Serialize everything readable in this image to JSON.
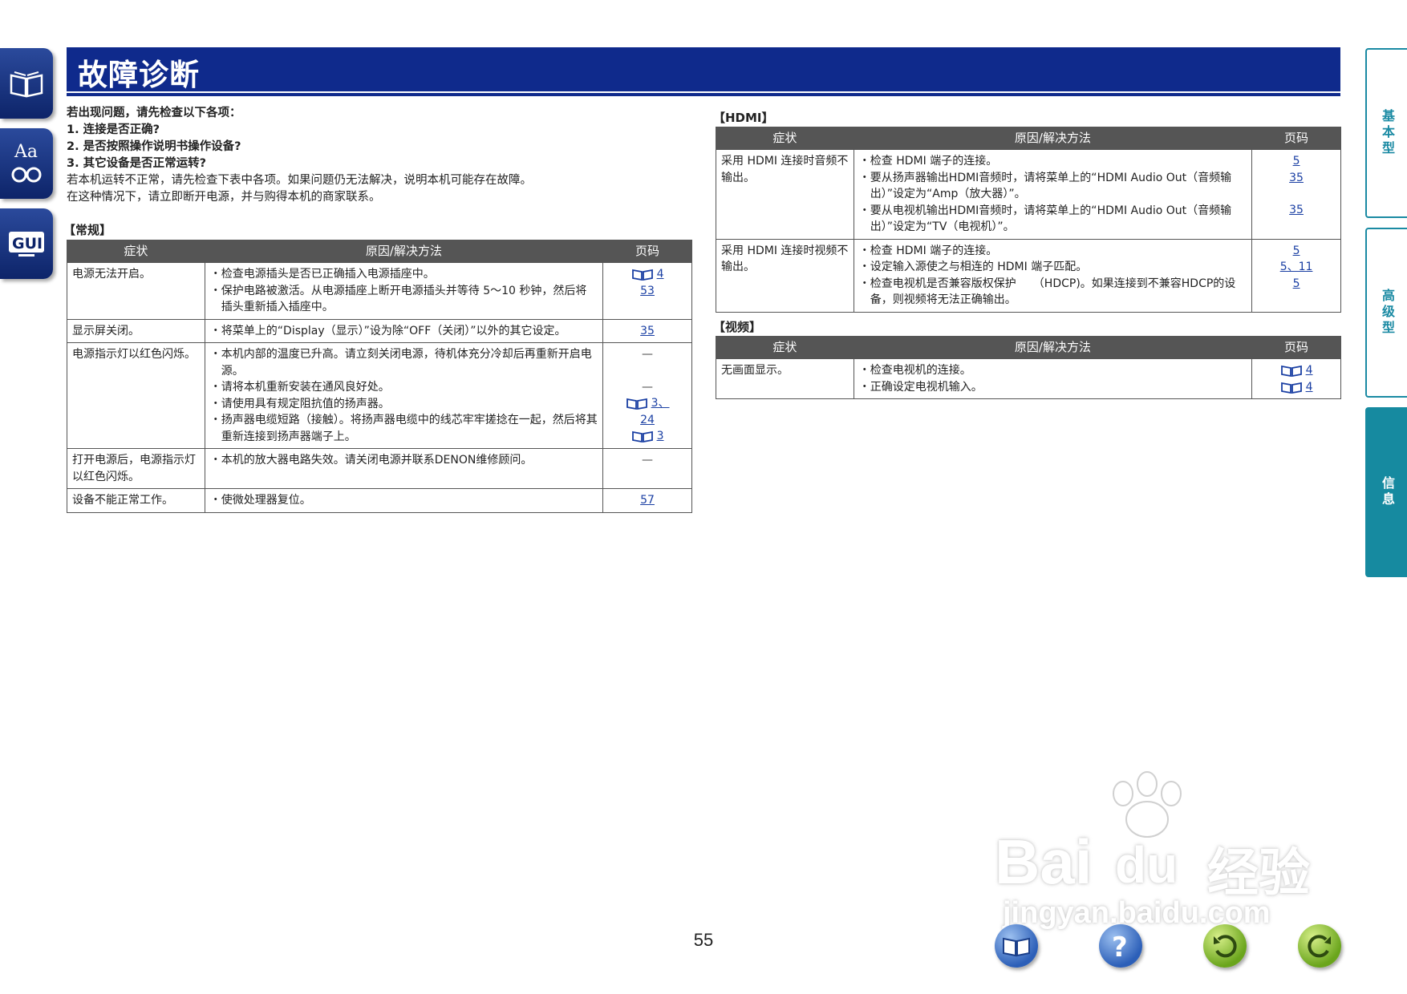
{
  "header": {
    "title": "故障诊断"
  },
  "right_tabs": [
    "基本型",
    "高级型",
    "信息"
  ],
  "intro": {
    "line1": "若出现问题，请先检查以下各项：",
    "line2": "1. 连接是否正确?",
    "line3": "2. 是否按照操作说明书操作设备?",
    "line4": "3. 其它设备是否正常运转?",
    "line5": "若本机运转不正常，请先检查下表中各项。如果问题仍无法解决，说明本机可能存在故障。",
    "line6": "在这种情况下，请立即断开电源，并与购得本机的商家联系。"
  },
  "columns": {
    "symptom": "症状",
    "cause": "原因/解决方法",
    "page": "页码"
  },
  "general": {
    "label": "【常规】",
    "rows": [
      {
        "symptom": "电源无法开启。",
        "causes": [
          "・检查电源插头是否已正确插入电源插座中。",
          "・保护电路被激活。从电源插座上断开电源插头并等待 5～10 秒钟，然后将插头重新插入插座中。"
        ],
        "pages": [
          "4",
          "53"
        ]
      },
      {
        "symptom": "显示屏关闭。",
        "causes": [
          "・将菜单上的“Display（显示）”设为除“OFF（关闭）”以外的其它设定。"
        ],
        "pages": [
          "35"
        ]
      },
      {
        "symptom": "电源指示灯以红色闪烁。",
        "causes": [
          "・本机内部的温度已升高。请立刻关闭电源，待机体充分冷却后再重新开启电源。",
          "・请将本机重新安装在通风良好处。",
          "・请使用具有规定阻抗值的扬声器。",
          "・扬声器电缆短路（接触）。将扬声器电缆中的线芯牢牢搓捻在一起，然后将其重新连接到扬声器端子上。"
        ],
        "pages": [
          "—",
          "—",
          "3、",
          "24",
          "3"
        ]
      },
      {
        "symptom": "打开电源后，电源指示灯以红色闪烁。",
        "causes": [
          "・本机的放大器电路失效。请关闭电源并联系DENON维修顾问。"
        ],
        "pages": [
          "—"
        ]
      },
      {
        "symptom": "设备不能正常工作。",
        "causes": [
          "・使微处理器复位。"
        ],
        "pages": [
          "57"
        ]
      }
    ]
  },
  "hdmi": {
    "label": "【HDMI】",
    "rows": [
      {
        "symptom": "采用 HDMI 连接时音频不输出。",
        "causes": [
          "・检查 HDMI 端子的连接。",
          "・要从扬声器输出HDMI音频时，请将菜单上的“HDMI Audio Out（音频输出）”设定为“Amp（放大器）”。",
          "・要从电视机输出HDMI音频时，请将菜单上的“HDMI Audio Out（音频输出）”设定为“TV（电视机）”。"
        ],
        "pages": [
          "5",
          "35",
          "35"
        ]
      },
      {
        "symptom": "采用 HDMI 连接时视频不输出。",
        "causes": [
          "・检查 HDMI 端子的连接。",
          "・设定输入源使之与相连的 HDMI 端子匹配。",
          "・检查电视机是否兼容版权保护　　（HDCP)。如果连接到不兼容HDCP的设备，则视频将无法正确输出。"
        ],
        "pages": [
          "5",
          "5、11",
          "5"
        ]
      }
    ]
  },
  "video": {
    "label": "【视频】",
    "rows": [
      {
        "symptom": "无画面显示。",
        "causes": [
          "・检查电视机的连接。",
          "・正确设定电视机输入。"
        ],
        "pages": [
          "4",
          "4"
        ]
      }
    ]
  },
  "page_number": "55",
  "watermark": {
    "brand": "Bai",
    "brand2": "du",
    "cn": "经验",
    "url": "jingyan.baidu.com"
  },
  "colors": {
    "header": "#0f2a8c",
    "tab_accent": "#168aa0",
    "table_header": "#555555",
    "link": "#1a3fa3"
  }
}
